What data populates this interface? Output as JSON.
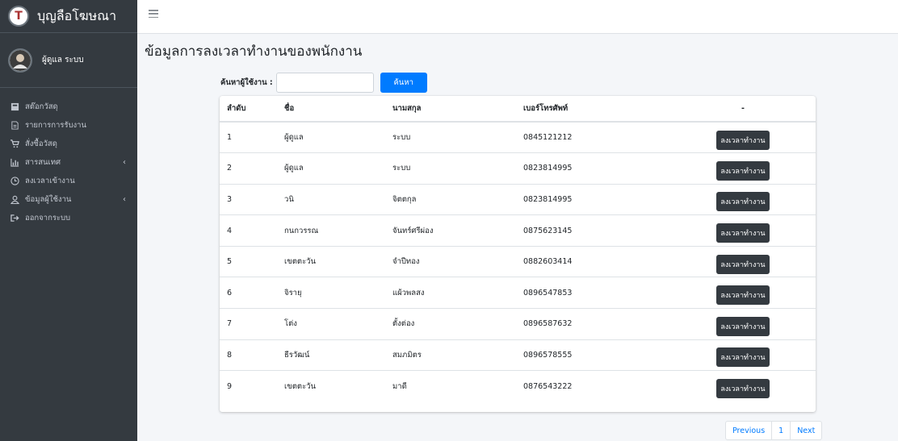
{
  "brand": {
    "logo_letter": "T",
    "name": "บุญลือโฆษณา"
  },
  "user": {
    "name": "ผู้ดูแล ระบบ"
  },
  "sidebar": {
    "items": [
      {
        "icon": "box-icon",
        "label": "สต๊อกวัสดุ",
        "caret": ""
      },
      {
        "icon": "document-icon",
        "label": "รายการการรับงาน",
        "caret": ""
      },
      {
        "icon": "cart-icon",
        "label": "สั่งซื้อวัสดุ",
        "caret": ""
      },
      {
        "icon": "chart-icon",
        "label": "สารสนเทศ",
        "caret": "‹"
      },
      {
        "icon": "clock-icon",
        "label": "ลงเวลาเข้างาน",
        "caret": ""
      },
      {
        "icon": "user-icon",
        "label": "ข้อมูลผู้ใช้งาน",
        "caret": "‹"
      },
      {
        "icon": "sign-out-icon",
        "label": "ออกจากระบบ",
        "caret": ""
      }
    ]
  },
  "main": {
    "title": "ข้อมูลการลงเวลาทำงานของพนักงาน",
    "search": {
      "label": "ค้นหาผู้ใช้งาน :",
      "placeholder": "",
      "button": "ค้นหา"
    },
    "table": {
      "headers": [
        "ลำดับ",
        "ชื่อ",
        "นามสกุล",
        "เบอร์โทรศัพท์",
        "-"
      ],
      "action_label": "ลงเวลาทำงาน",
      "rows": [
        [
          "1",
          "ผู้ดูแล",
          "ระบบ",
          "0845121212"
        ],
        [
          "2",
          "ผู้ดูแล",
          "ระบบ",
          "0823814995"
        ],
        [
          "3",
          "วนิ",
          "จิตตกุล",
          "0823814995"
        ],
        [
          "4",
          "กนกวรรณ",
          "จันทร์ศรีผ่อง",
          "0875623145"
        ],
        [
          "5",
          "เขตตะวัน",
          "จำปีทอง",
          "0882603414"
        ],
        [
          "6",
          "จิรายุ",
          "แผ้วพลสง",
          "0896547853"
        ],
        [
          "7",
          "โต่ง",
          "ตั้งต่อง",
          "0896587632"
        ],
        [
          "8",
          "ธีรวัฒน์",
          "สมภมิตร",
          "0896578555"
        ],
        [
          "9",
          "เขตตะวัน",
          "มาดี",
          "0876543222"
        ]
      ]
    },
    "pagination": {
      "previous": "Previous",
      "page": "1",
      "next": "Next"
    }
  },
  "colors": {
    "sidebar": "#343a40",
    "primary": "#007bff",
    "action": "#343a40"
  }
}
